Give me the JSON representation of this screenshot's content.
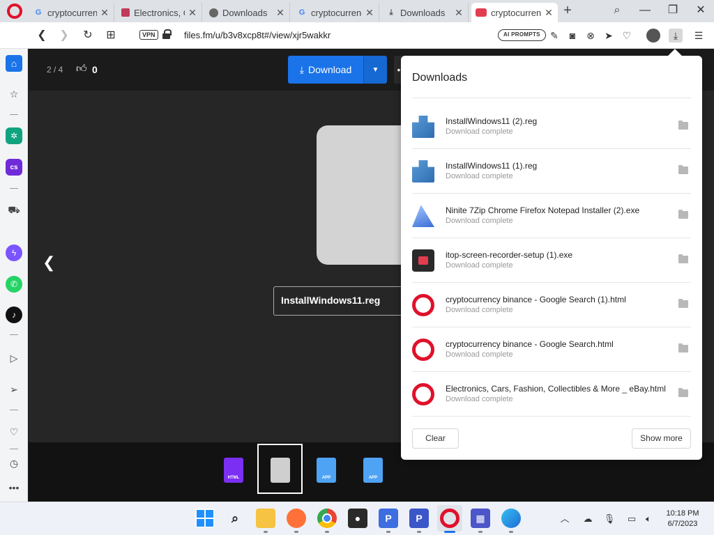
{
  "browser": {
    "tabs": [
      {
        "title": "cryptocurrenc",
        "favicon": "google-icon"
      },
      {
        "title": "Electronics, C",
        "favicon": "ebay-icon"
      },
      {
        "title": "Downloads",
        "favicon": "globe-icon"
      },
      {
        "title": "cryptocurrenc",
        "favicon": "google-icon"
      },
      {
        "title": "Downloads",
        "favicon": "download-icon"
      },
      {
        "title": "cryptocurrenc",
        "favicon": "crypto-icon",
        "active": true
      }
    ],
    "address": {
      "vpn_label": "VPN",
      "url": "files.fm/u/b3v8xcp8t#/view/xjr5wakkr",
      "ai_prompts_label": "AI PROMPTS"
    }
  },
  "page": {
    "pager": "2 / 4",
    "like_count": "0",
    "download_label": "Download",
    "filename": "InstallWindows11.reg",
    "thumbnails": [
      {
        "label": "HTML",
        "kind": "html"
      },
      {
        "label": "",
        "kind": "reg",
        "selected": true
      },
      {
        "label": "APP",
        "kind": "app"
      },
      {
        "label": "APP",
        "kind": "app"
      }
    ]
  },
  "downloads_panel": {
    "title": "Downloads",
    "items": [
      {
        "name": "InstallWindows11 (2).reg",
        "status": "Download complete",
        "icon": "registry-icon"
      },
      {
        "name": "InstallWindows11 (1).reg",
        "status": "Download complete",
        "icon": "registry-icon"
      },
      {
        "name": "Ninite 7Zip Chrome Firefox Notepad Installer (2).exe",
        "status": "Download complete",
        "icon": "ninite-icon"
      },
      {
        "name": "itop-screen-recorder-setup (1).exe",
        "status": "Download complete",
        "icon": "itop-icon"
      },
      {
        "name": "cryptocurrency binance - Google Search (1).html",
        "status": "Download complete",
        "icon": "opera-icon"
      },
      {
        "name": "cryptocurrency binance - Google Search.html",
        "status": "Download complete",
        "icon": "opera-icon"
      },
      {
        "name": "Electronics, Cars, Fashion, Collectibles & More _ eBay.html",
        "status": "Download complete",
        "icon": "opera-icon"
      }
    ],
    "clear_label": "Clear",
    "show_more_label": "Show more"
  },
  "taskbar": {
    "time": "10:18 PM",
    "date": "6/7/2023",
    "p1_label": "P",
    "p2_label": "P"
  },
  "colors": {
    "accent": "#1a73e8",
    "opera_red": "#e0112b",
    "page_bg": "#1b1b1b"
  }
}
